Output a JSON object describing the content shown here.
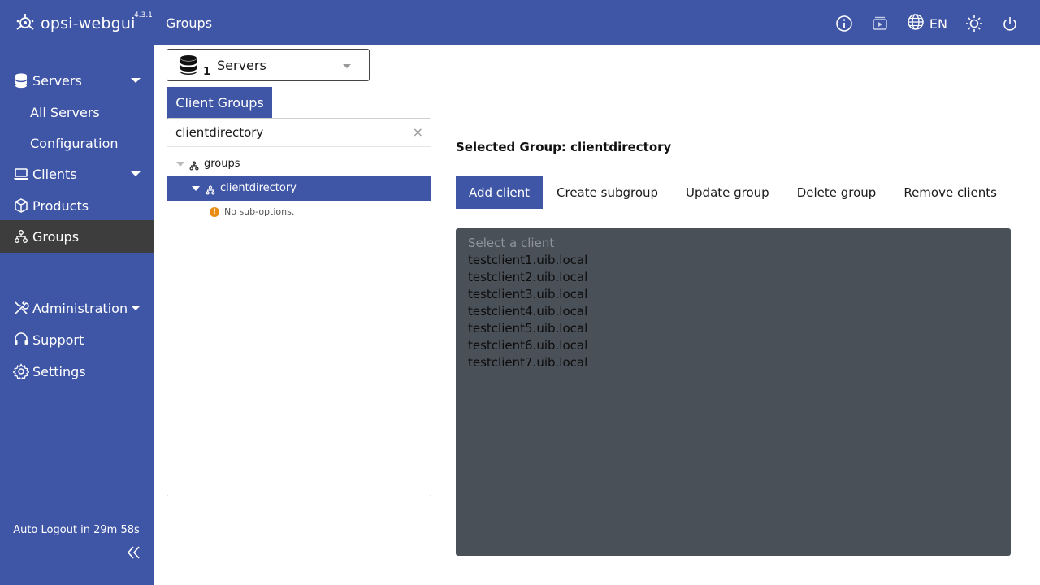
{
  "header": {
    "app_name": "opsi-webgui",
    "version": "4.3.1",
    "page_title": "Groups",
    "language": "EN"
  },
  "sidebar": {
    "items": [
      {
        "label": "Servers",
        "icon": "database-icon",
        "expandable": true
      },
      {
        "label": "All Servers",
        "sub": true
      },
      {
        "label": "Configuration",
        "sub": true
      },
      {
        "label": "Clients",
        "icon": "laptop-icon",
        "expandable": true
      },
      {
        "label": "Products",
        "icon": "box-icon",
        "expandable": false
      },
      {
        "label": "Groups",
        "icon": "sitemap-icon",
        "active": true
      },
      {
        "label": "Administration",
        "icon": "tools-icon",
        "expandable": true
      },
      {
        "label": "Support",
        "icon": "headset-icon"
      },
      {
        "label": "Settings",
        "icon": "gear-icon"
      }
    ],
    "auto_logout": "Auto Logout in 29m 58s"
  },
  "server_select": {
    "count": "1",
    "label": "Servers"
  },
  "tabs": [
    {
      "label": "Client Groups",
      "active": true
    }
  ],
  "tree": {
    "search_value": "clientdirectory",
    "clear_symbol": "×",
    "nodes": [
      {
        "label": "groups",
        "level": 0
      },
      {
        "label": "clientdirectory",
        "level": 1,
        "selected": true
      }
    ],
    "no_sub_options": "No sub-options."
  },
  "main": {
    "selected_group": "Selected Group: clientdirectory",
    "actions": [
      "Add client",
      "Create subgroup",
      "Update group",
      "Delete group",
      "Remove clients"
    ],
    "client_placeholder": "Select a client",
    "clients": [
      "testclient1.uib.local",
      "testclient2.uib.local",
      "testclient3.uib.local",
      "testclient4.uib.local",
      "testclient5.uib.local",
      "testclient6.uib.local",
      "testclient7.uib.local"
    ]
  },
  "colors": {
    "brand": "#3f55a6",
    "active_nav": "#3d3d3d",
    "list_bg": "#4a5058",
    "warning": "#e98c12"
  }
}
